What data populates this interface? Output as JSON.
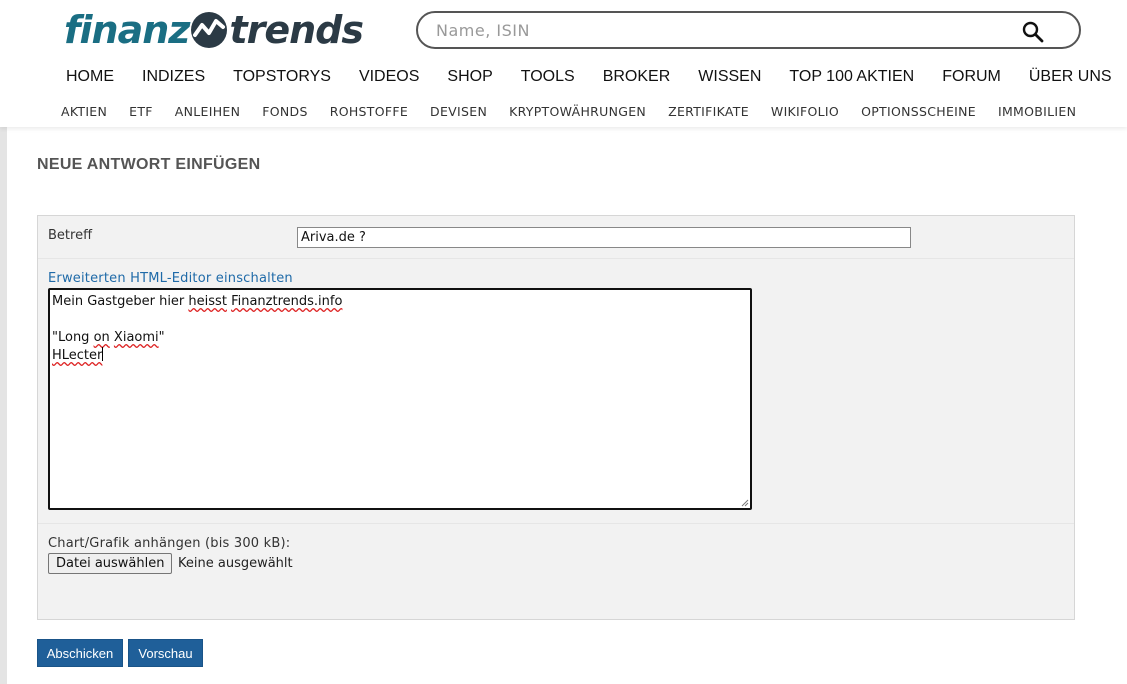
{
  "header": {
    "logo": {
      "part1": "finanz",
      "part2": "trends",
      "colors": {
        "primary": "#1a6e83",
        "secondary": "#2b3a45"
      }
    },
    "search": {
      "placeholder": "Name, ISIN",
      "value": "",
      "icon": "search-icon"
    },
    "nav_main": [
      "HOME",
      "INDIZES",
      "TOPSTORYS",
      "VIDEOS",
      "SHOP",
      "TOOLS",
      "BROKER",
      "WISSEN",
      "TOP 100 AKTIEN",
      "FORUM",
      "ÜBER UNS"
    ],
    "nav_sub": [
      "AKTIEN",
      "ETF",
      "ANLEIHEN",
      "FONDS",
      "ROHSTOFFE",
      "DEVISEN",
      "KRYPTOWÄHRUNGEN",
      "ZERTIFIKATE",
      "WIKIFOLIO",
      "OPTIONSSCHEINE",
      "IMMOBILIEN"
    ]
  },
  "main": {
    "title": "NEUE ANTWORT EINFÜGEN",
    "form": {
      "betreff_label": "Betreff",
      "betreff_value": "Ariva.de ?",
      "html_editor_link": "Erweiterten HTML-Editor einschalten",
      "message_lines": {
        "l1_a": "Mein Gastgeber hier ",
        "l1_b": "heisst",
        "l1_c": " ",
        "l1_d": "Finanztrends.info",
        "l3_a": "\"Long ",
        "l3_b": "on",
        "l3_c": " ",
        "l3_d": "Xiaomi",
        "l3_e": "\"",
        "l4": "HLecter"
      },
      "attach_label": "Chart/Grafik anhängen (bis 300 kB):",
      "file_button": "Datei auswählen",
      "file_status": "Keine ausgewählt"
    },
    "buttons": {
      "submit": "Abschicken",
      "preview": "Vorschau"
    },
    "colors": {
      "button_bg": "#1f5f99",
      "link": "#1f6aa8",
      "form_bg": "#f2f2f2"
    }
  }
}
